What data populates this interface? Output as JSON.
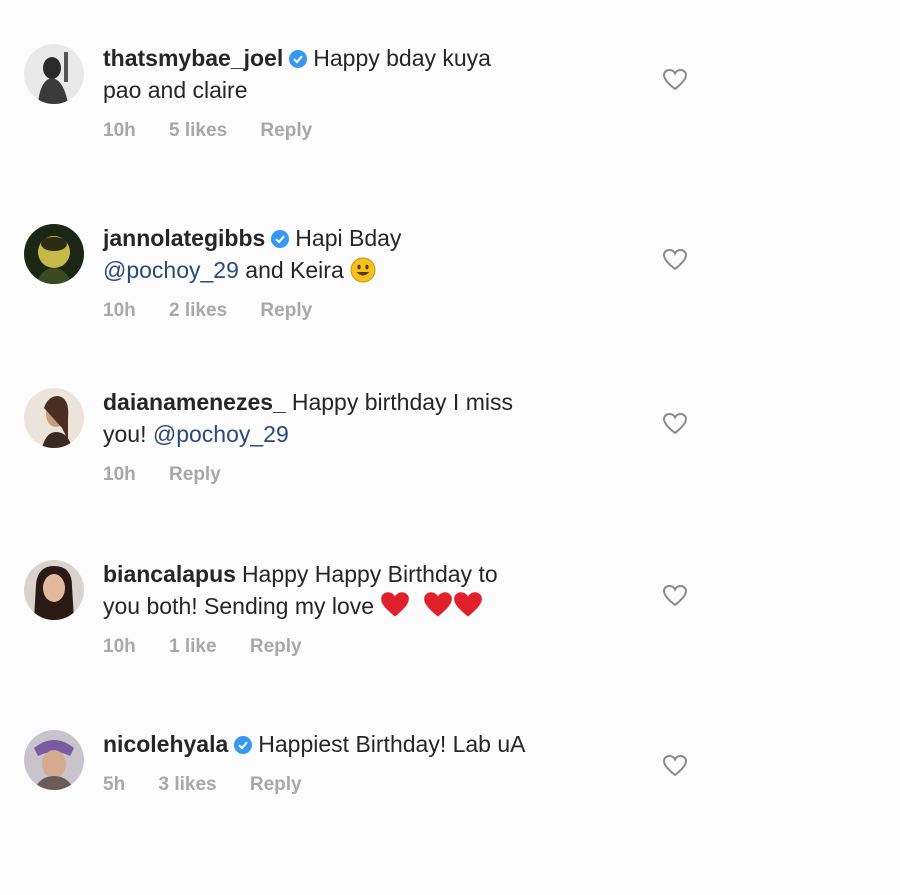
{
  "comments": [
    {
      "username": "thatsmybae_joel",
      "verified": true,
      "parts": [
        "Happy bday kuya",
        "pao and claire"
      ],
      "time": "10h",
      "likes": "5 likes",
      "reply": "Reply"
    },
    {
      "username": "jannolategibbs",
      "verified": true,
      "line1": "Hapi Bday",
      "mention": "@pochoy_29",
      "line2": "and Keira",
      "emoji": "grinning-face-emoji",
      "time": "10h",
      "likes": "2 likes",
      "reply": "Reply"
    },
    {
      "username": "daianamenezes_",
      "verified": false,
      "line1": "Happy birthday I miss",
      "line2": "you!",
      "mention": "@pochoy_29",
      "time": "10h",
      "reply": "Reply"
    },
    {
      "username": "biancalapus",
      "verified": false,
      "line1": "Happy Happy Birthday to",
      "line2": "you both! Sending my love",
      "emoji": "red-heart-emoji",
      "time": "10h",
      "likes": "1 like",
      "reply": "Reply"
    },
    {
      "username": "nicolehyala",
      "verified": true,
      "line1": "Happiest Birthday! Lab uA",
      "time": "5h",
      "likes": "3 likes",
      "reply": "Reply"
    }
  ],
  "colors": {
    "verified": "#3897f0",
    "meta": "#a8a8a8",
    "text": "#262626",
    "heart_emoji": "#e0202a"
  }
}
